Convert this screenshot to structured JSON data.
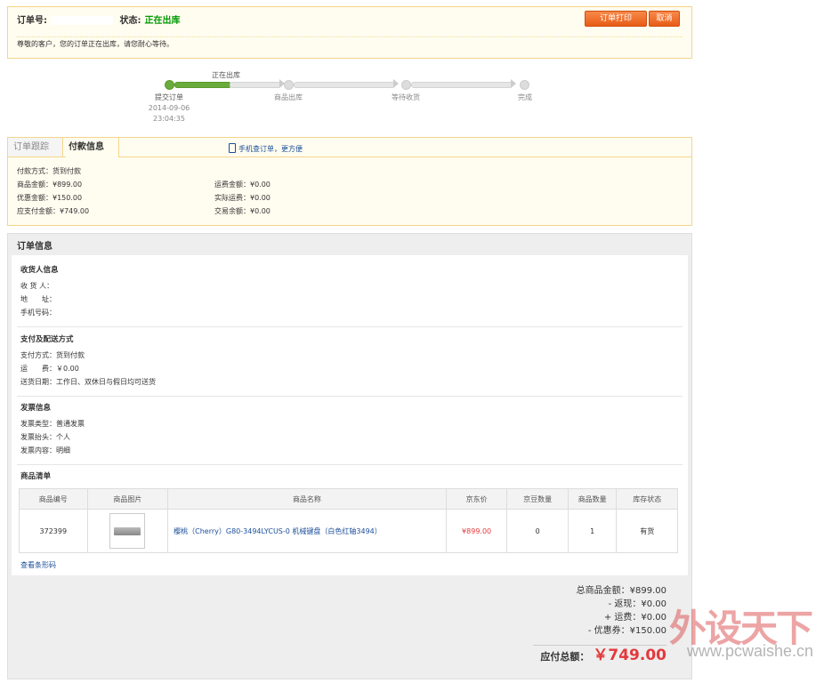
{
  "header": {
    "order_no_label": "订单号:",
    "status_label": "状态:",
    "status_value": "正在出库",
    "notice": "尊敬的客户，您的订单正在出库，请您耐心等待。",
    "print_button": "订单打印",
    "cancel_button": "取消"
  },
  "progress": {
    "current_label": "正在出库",
    "steps": [
      {
        "label": "提交订单",
        "date": "2014-09-06",
        "time": "23:04:35"
      },
      {
        "label": "商品出库"
      },
      {
        "label": "等待收货"
      },
      {
        "label": "完成"
      }
    ]
  },
  "payment": {
    "tabs": [
      "订单跟踪",
      "付款信息"
    ],
    "mobile_link": "手机查订单，更方便",
    "left": [
      "付款方式：货到付款",
      "商品金额：¥899.00",
      "优惠金额：¥150.00",
      "应支付金额：¥749.00"
    ],
    "right": [
      "运费金额：¥0.00",
      "实际运费：¥0.00",
      "交易余额：¥0.00"
    ]
  },
  "order_info": {
    "title": "订单信息",
    "receiver": {
      "heading": "收货人信息",
      "lines": [
        "收 货 人：",
        "地　　址：",
        "手机号码："
      ]
    },
    "shipping": {
      "heading": "支付及配送方式",
      "lines": [
        "支付方式：货到付款",
        "运　　费：￥0.00",
        "送货日期：工作日、双休日与假日均可送货"
      ]
    },
    "invoice": {
      "heading": "发票信息",
      "lines": [
        "发票类型：普通发票",
        "发票抬头：个人",
        "发票内容：明细"
      ]
    },
    "goods": {
      "heading": "商品清单",
      "columns": [
        "商品编号",
        "商品图片",
        "商品名称",
        "京东价",
        "京豆数量",
        "商品数量",
        "库存状态"
      ],
      "rows": [
        {
          "id": "372399",
          "name": "樱桃（Cherry）G80-3494LYCUS-0 机械键盘（白色红轴3494）",
          "price": "¥899.00",
          "beans": "0",
          "qty": "1",
          "stock": "有货"
        }
      ],
      "barcode_link": "查看条形码"
    }
  },
  "totals": {
    "lines": [
      "总商品金额：¥899.00",
      "- 返现：¥0.00",
      "+ 运费：¥0.00",
      "- 优惠券：¥150.00"
    ],
    "grand_label": "应付总额：",
    "grand_value": "￥749.00"
  },
  "watermark": {
    "text": "外设天下",
    "url": "www.pcwaishe.cn"
  }
}
